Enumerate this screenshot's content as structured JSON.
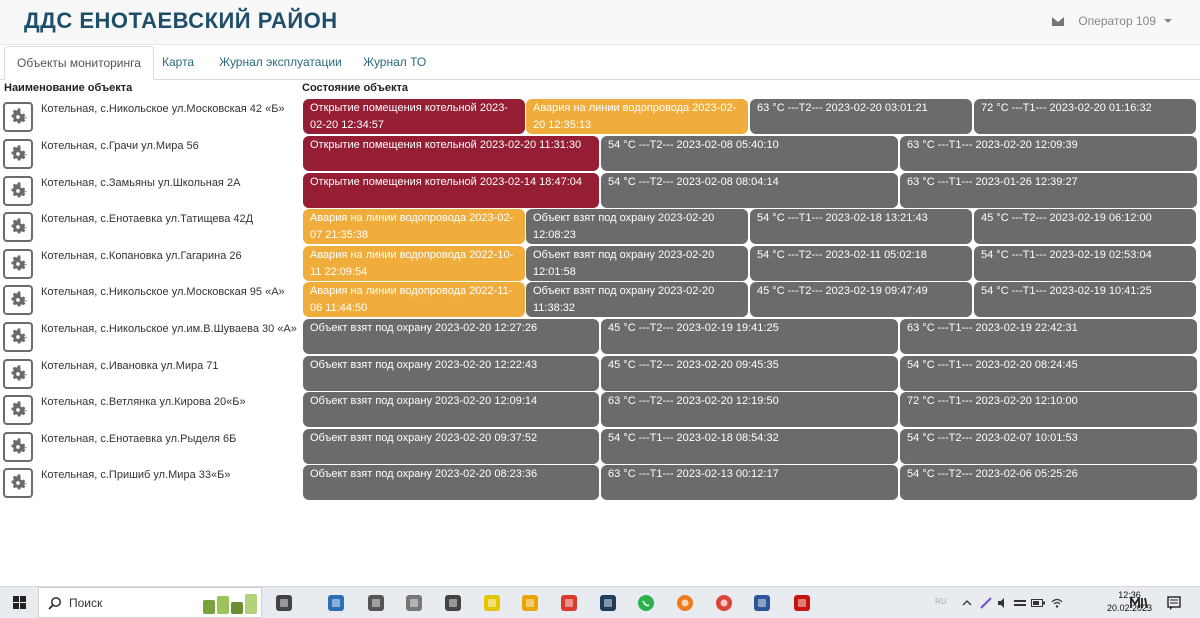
{
  "header": {
    "title": "ДДС ЕНОТАЕВСКИЙ РАЙОН",
    "operator": "Оператор 109"
  },
  "tabs": [
    {
      "label": "Объекты мониторинга",
      "active": true
    },
    {
      "label": "Карта",
      "active": false
    },
    {
      "label": "Журнал эксплуатации",
      "active": false
    },
    {
      "label": "Журнал ТО",
      "active": false
    }
  ],
  "table": {
    "col_name": "Наименование объекта",
    "col_state": "Состояние объекта",
    "rows": [
      {
        "name": "Котельная, с.Никольское ул.Московская 42 «Б»",
        "cells": [
          {
            "text": "Открытие помещения котельной 2023-02-20 12:34:57",
            "color": "red"
          },
          {
            "text": "Авария на линии водопровода 2023-02-20 12:35:13",
            "color": "orange"
          },
          {
            "text": "63 °C ---T2--- 2023-02-20 03:01:21",
            "color": "gray"
          },
          {
            "text": "72 °C ---T1--- 2023-02-20 01:16:32",
            "color": "gray"
          }
        ]
      },
      {
        "name": "Котельная, с.Грачи ул.Мира 56",
        "cells": [
          {
            "text": "Открытие помещения котельной 2023-02-20 11:31:30",
            "color": "red"
          },
          {
            "text": "54 °C ---T2--- 2023-02-08 05:40:10",
            "color": "gray"
          },
          {
            "text": "63 °C ---T1--- 2023-02-20 12:09:39",
            "color": "gray"
          }
        ]
      },
      {
        "name": "Котельная, с.Замьяны ул.Школьная 2А",
        "cells": [
          {
            "text": "Открытие помещения котельной 2023-02-14 18:47:04",
            "color": "red"
          },
          {
            "text": "54 °C ---T2--- 2023-02-08 08:04:14",
            "color": "gray"
          },
          {
            "text": "63 °C ---T1--- 2023-01-26 12:39:27",
            "color": "gray"
          }
        ]
      },
      {
        "name": "Котельная, с.Енотаевка ул.Татищева 42Д",
        "cells": [
          {
            "text": "Авария на линии водопровода 2023-02-07 21:35:38",
            "color": "orange"
          },
          {
            "text": "Объект взят под охрану 2023-02-20 12:08:23",
            "color": "gray"
          },
          {
            "text": "54 °C ---T1--- 2023-02-18 13:21:43",
            "color": "gray"
          },
          {
            "text": "45 °C ---T2--- 2023-02-19 06:12:00",
            "color": "gray"
          }
        ]
      },
      {
        "name": "Котельная, с.Копановка ул.Гагарина 26",
        "cells": [
          {
            "text": "Авария на линии водопровода 2022-10-11 22:09:54",
            "color": "orange"
          },
          {
            "text": "Объект взят под охрану 2023-02-20 12:01:58",
            "color": "gray"
          },
          {
            "text": "54 °C ---T2--- 2023-02-11 05:02:18",
            "color": "gray"
          },
          {
            "text": "54 °C ---T1--- 2023-02-19 02:53:04",
            "color": "gray"
          }
        ]
      },
      {
        "name": "Котельная, с.Никольское ул.Московская 95 «А»",
        "cells": [
          {
            "text": "Авария на линии водопровода 2022-11-06 11:44:50",
            "color": "orange"
          },
          {
            "text": "Объект взят под охрану 2023-02-20 11:38:32",
            "color": "gray"
          },
          {
            "text": "45 °C ---T2--- 2023-02-19 09:47:49",
            "color": "gray"
          },
          {
            "text": "54 °C ---T1--- 2023-02-19 10:41:25",
            "color": "gray"
          }
        ]
      },
      {
        "name": "Котельная, с.Никольское ул.им.В.Шуваева 30 «А»",
        "cells": [
          {
            "text": "Объект взят под охрану 2023-02-20 12:27:26",
            "color": "gray"
          },
          {
            "text": "45 °C ---T2--- 2023-02-19 19:41:25",
            "color": "gray"
          },
          {
            "text": "63 °C ---T1--- 2023-02-19 22:42:31",
            "color": "gray"
          }
        ]
      },
      {
        "name": "Котельная, с.Ивановка ул.Мира 71",
        "cells": [
          {
            "text": "Объект взят под охрану 2023-02-20 12:22:43",
            "color": "gray"
          },
          {
            "text": "45 °C ---T2--- 2023-02-20 09:45:35",
            "color": "gray"
          },
          {
            "text": "54 °C ---T1--- 2023-02-20 08:24:45",
            "color": "gray"
          }
        ]
      },
      {
        "name": "Котельная, с.Ветлянка ул.Кирова 20«Б»",
        "cells": [
          {
            "text": "Объект взят под охрану 2023-02-20 12:09:14",
            "color": "gray"
          },
          {
            "text": "63 °C ---T2--- 2023-02-20 12:19:50",
            "color": "gray"
          },
          {
            "text": "72 °C ---T1--- 2023-02-20 12:10:00",
            "color": "gray"
          }
        ]
      },
      {
        "name": "Котельная, с.Енотаевка ул.Рыделя 6Б",
        "cells": [
          {
            "text": "Объект взят под охрану 2023-02-20 09:37:52",
            "color": "gray"
          },
          {
            "text": "54 °C ---T1--- 2023-02-18 08:54:32",
            "color": "gray"
          },
          {
            "text": "54 °C ---T2--- 2023-02-07 10:01:53",
            "color": "gray"
          }
        ]
      },
      {
        "name": "Котельная, с.Пришиб ул.Мира 33«Б»",
        "cells": [
          {
            "text": "Объект взят под охрану 2023-02-20 08:23:36",
            "color": "gray"
          },
          {
            "text": "63 °C ---T1--- 2023-02-13 00:12:17",
            "color": "gray"
          },
          {
            "text": "54 °C ---T2--- 2023-02-06 05:25:26",
            "color": "gray"
          }
        ]
      }
    ]
  },
  "colors": {
    "red": "#951d34",
    "orange": "#f0ad3b",
    "gray": "#6b6b6b",
    "brand": "#1f4e6b",
    "tab_link": "#2a6a7f"
  },
  "taskbar": {
    "search_label": "Поиск",
    "time": "12:36",
    "date": "20.02.2023",
    "lang": "RU",
    "apps": [
      "task-view-icon",
      "mail-app-icon",
      "scanner-app-icon",
      "usb-app-icon",
      "settings-app-icon",
      "sticky-notes-app-icon",
      "file-explorer-app-icon",
      "anydesk-app-icon",
      "messenger-app-icon",
      "whatsapp-app-icon",
      "firefox-app-icon",
      "chrome-app-icon",
      "word-app-icon",
      "acrobat-app-icon"
    ]
  }
}
